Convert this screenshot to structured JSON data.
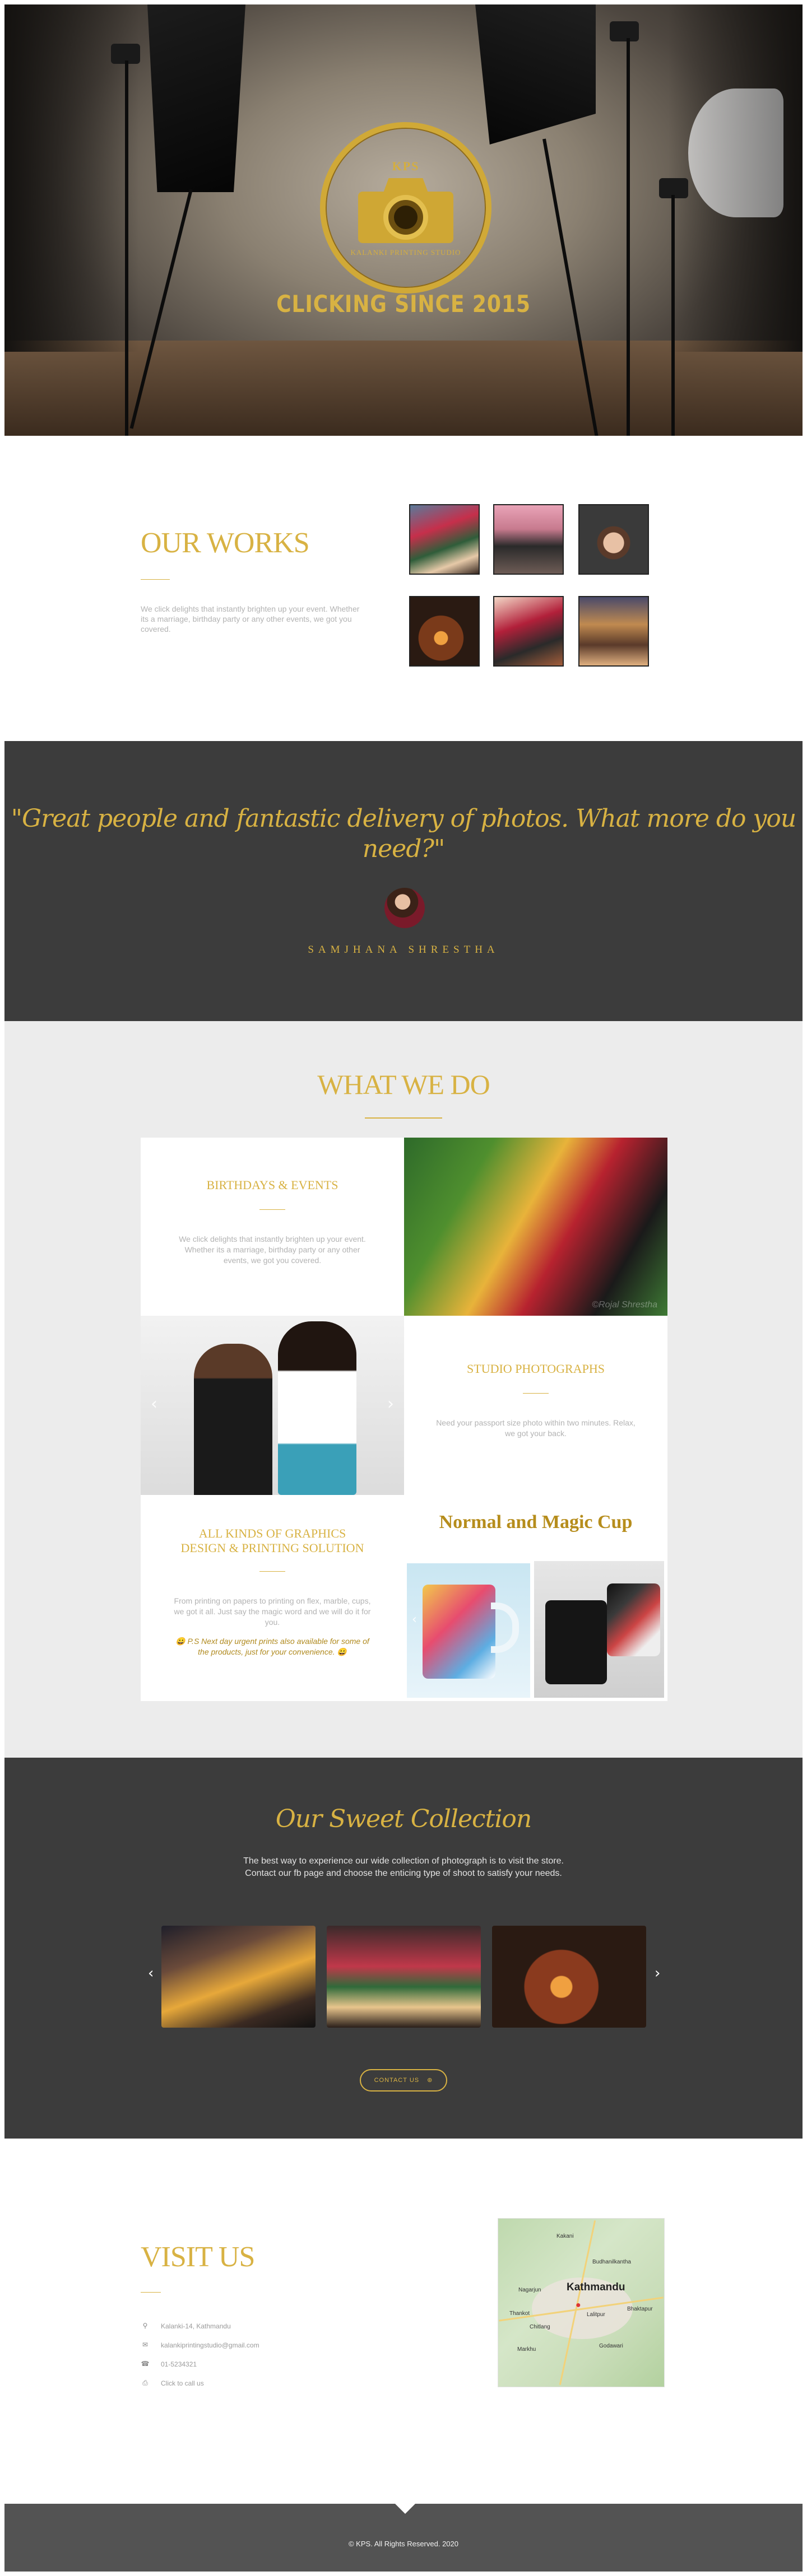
{
  "hero": {
    "logo_abbr": "KPS",
    "logo_name": "KALANKI PRINTING STUDIO",
    "tagline": "CLICKING SINCE 2015"
  },
  "works": {
    "title": "OUR WORKS",
    "text": "We click delights that instantly brighten up your event. Whether its a marriage, birthday party or any other events, we got you covered."
  },
  "testimonial": {
    "quote": "\"Great people and fantastic delivery of photos. What more do you need?\"",
    "name": "SAMJHANA SHRESTHA"
  },
  "services": {
    "title": "WHAT WE DO",
    "birthdays_title": "BIRTHDAYS & EVENTS",
    "birthdays_text": "We click delights that instantly brighten up your event. Whether its a marriage, birthday party or any other events, we got you covered.",
    "photo_watermark": "©Rojal Shrestha",
    "studio_title": "STUDIO PHOTOGRAPHS",
    "studio_text": "Need your passport size photo within two minutes. Relax, we got your back.",
    "graphics_title": "ALL KINDS OF GRAPHICS DESIGN & PRINTING SOLUTION",
    "graphics_text": "From printing on papers to printing on flex, marble, cups, we got it all. Just say the magic word and we will do it for you.",
    "graphics_note": "😀 P.S Next day urgent prints also available for some of the products, just for your convenience. 😀",
    "cup_title": "Normal and Magic Cup",
    "arrow_prev": "‹",
    "arrow_next": "›"
  },
  "collection": {
    "title": "Our Sweet Collection",
    "text_line1": "The best way to experience our wide collection of photograph is to visit the store.",
    "text_line2": "Contact our fb page and choose the enticing type of shoot to satisfy your needs.",
    "arrow_prev": "‹",
    "arrow_next": "›",
    "button": "CONTACT US"
  },
  "visit": {
    "title": "VISIT US",
    "address": "Kalanki-14, Kathmandu",
    "email": "kalankiprintingstudio@gmail.com",
    "phone": "01-5234321",
    "call": "Click to call us"
  },
  "map": {
    "labels": [
      "Kakani",
      "Budhanilkantha",
      "Nagarjun",
      "Kathmandu",
      "Bhaktapur",
      "Lalitpur",
      "Chitlang",
      "Godawari",
      "Markhu",
      "Thankot"
    ]
  },
  "footer": {
    "copyright": "© KPS. All Rights Reserved. 2020"
  },
  "icons": {
    "location": "pin-icon",
    "email": "envelope-icon",
    "phone": "phone-icon",
    "call": "print-icon",
    "button": "chevron-circle-icon"
  },
  "colors": {
    "gold": "#d8b243",
    "dark": "#3c3c3c",
    "light": "#ececec",
    "footer": "#535353"
  }
}
